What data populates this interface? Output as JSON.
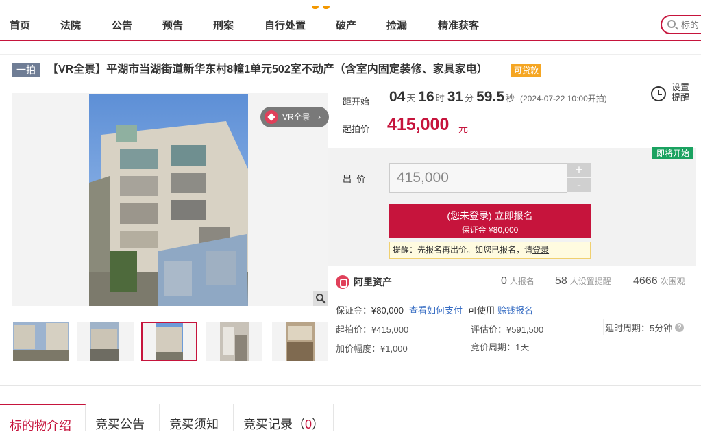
{
  "nav": {
    "items": [
      "首页",
      "法院",
      "公告",
      "预告",
      "刑案",
      "自行处置",
      "破产",
      "捡漏",
      "精准获客"
    ],
    "search_placeholder": "标的"
  },
  "title": {
    "tag": "一拍",
    "text": "【VR全景】平湖市当湖街道新华东村8幢1单元502室不动产（含室内固定装修、家具家电）",
    "loan_tag": "可贷款"
  },
  "gallery": {
    "vr_label": "VR全景",
    "vr_arrow": "›",
    "active_thumb_index": 2
  },
  "countdown": {
    "label": "距开始",
    "days": "04",
    "days_unit": "天",
    "hours": "16",
    "hours_unit": "时",
    "minutes": "31",
    "minutes_unit": "分",
    "seconds": "59.5",
    "seconds_unit": "秒",
    "open_time": "(2024-07-22 10:00开拍)"
  },
  "reminder": {
    "label": "设置提醒"
  },
  "start_price": {
    "label": "起拍价",
    "value": "415,000",
    "unit": "元"
  },
  "status_tag": "即将开始",
  "bid": {
    "label": "出  价",
    "value": "415,000",
    "plus": "+",
    "minus": "-",
    "signup_line1": "(您未登录) 立即报名",
    "signup_line2": "保证金 ¥80,000",
    "tip_text": "提醒：先报名再出价。如您已报名，请",
    "tip_link": "登录"
  },
  "stats": {
    "provider": "阿里资产",
    "signups": "0",
    "signups_label": "人报名",
    "reminders": "58",
    "reminders_label": "人设置提醒",
    "views": "4666",
    "views_label": "次围观"
  },
  "deposit": {
    "text": "保证金：¥80,000",
    "how_to_pay": "查看如何支付",
    "can_use": "可使用",
    "credit_link": "赊钱报名"
  },
  "details": {
    "start_price": "起拍价：¥415,000",
    "appraisal": "评估价：¥591,500",
    "delay": "延时周期：5分钟",
    "increment": "加价幅度：¥1,000",
    "period": "竞价周期：1天"
  },
  "tabs": [
    "标的物介绍",
    "竞买公告",
    "竞买须知",
    "竞买记录（",
    "0",
    "）"
  ],
  "colors": {
    "brand": "#c6143c",
    "loan": "#f5a623",
    "status": "#1aa260",
    "link": "#3a6fc4"
  }
}
